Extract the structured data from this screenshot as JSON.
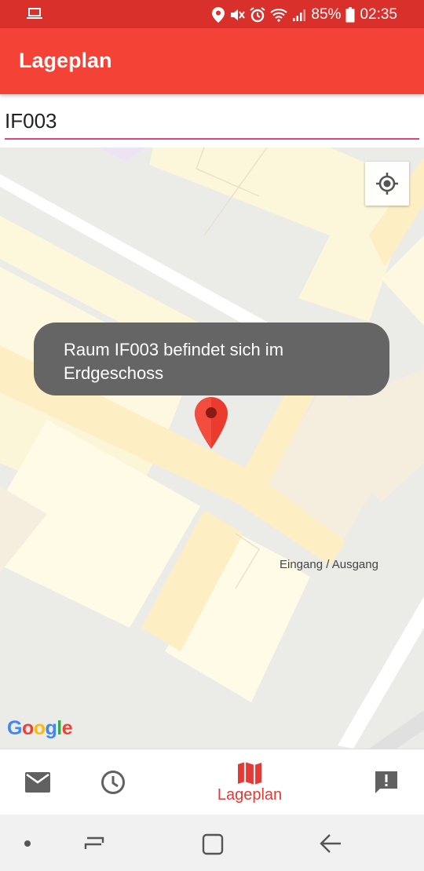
{
  "status_bar": {
    "battery_percent": "85%",
    "time": "02:35"
  },
  "app_bar": {
    "title": "Lageplan"
  },
  "search": {
    "value": "IF003"
  },
  "toast": {
    "message": "Raum IF003 befindet sich im Erdgeschoss"
  },
  "map": {
    "labels": [
      "Eingang / Ausgang"
    ],
    "attribution": "Google"
  },
  "bottom_nav": {
    "items": [
      {
        "icon": "mail-icon",
        "label": ""
      },
      {
        "icon": "clock-icon",
        "label": ""
      },
      {
        "icon": "map-icon",
        "label": "Lageplan",
        "active": true
      },
      {
        "icon": "feedback-icon",
        "label": ""
      }
    ]
  },
  "colors": {
    "primary": "#f44336",
    "status_bar": "#d9302c",
    "accent": "#e0457a",
    "active_nav": "#e53935"
  }
}
